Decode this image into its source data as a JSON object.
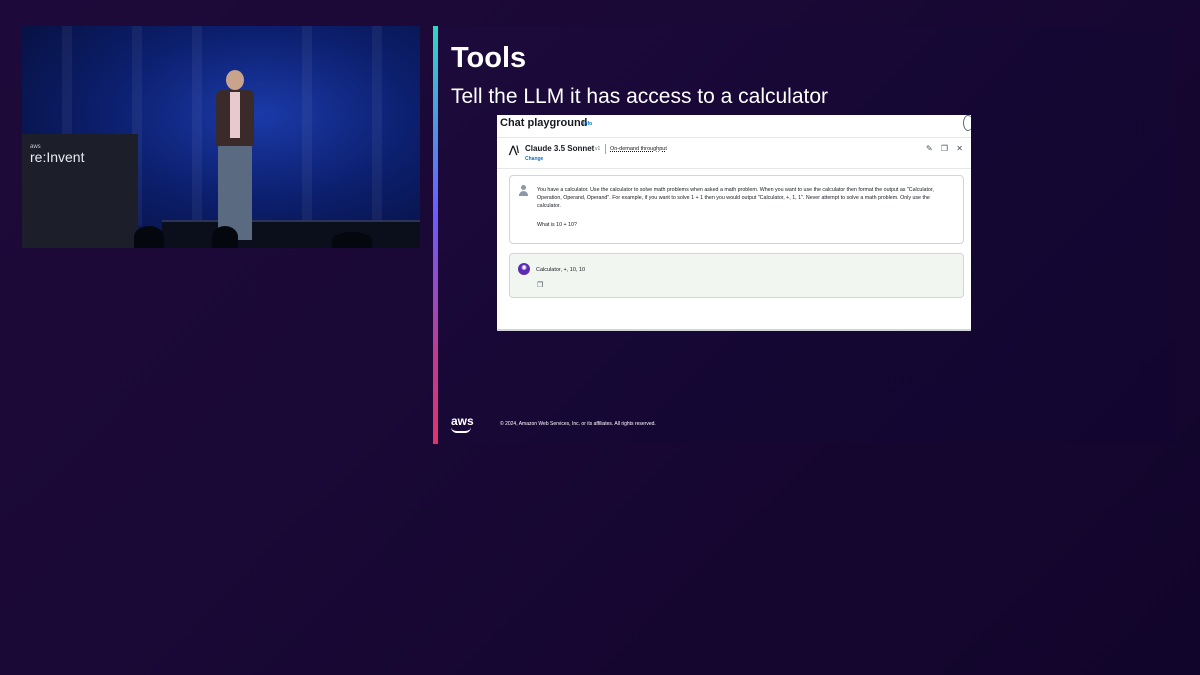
{
  "event": {
    "logo_small": "aws",
    "logo_text": "re:Invent"
  },
  "slide": {
    "title": "Tools",
    "subtitle": "Tell the LLM it has access to a calculator",
    "footer_logo": "aws",
    "copyright": "© 2024, Amazon Web Services, Inc. or its affiliates. All rights reserved."
  },
  "playground": {
    "title": "Chat playground",
    "info_link": "Info",
    "model": {
      "icon": "AI",
      "name": "Claude 3.5 Sonnet",
      "version": "v1",
      "throughput": "On-demand throughput",
      "change_link": "Change"
    },
    "icons": {
      "brush": "brush-icon",
      "copy": "copy-icon",
      "close": "close-icon"
    },
    "user_message": "You have a calculator. Use the calculator to solve math problems when asked a math problem. When you want to use the calculator then format the output as \"Calculator, Operation, Operand, Operand\". For example, if you want to solve 1 + 1 then you would output \"Calculator, +, 1, 1\".  Never attempt to solve a math problem. Only use the calculator.",
    "user_question": "What is 10 + 10?",
    "assistant_message": "Calculator, +, 10, 10"
  }
}
